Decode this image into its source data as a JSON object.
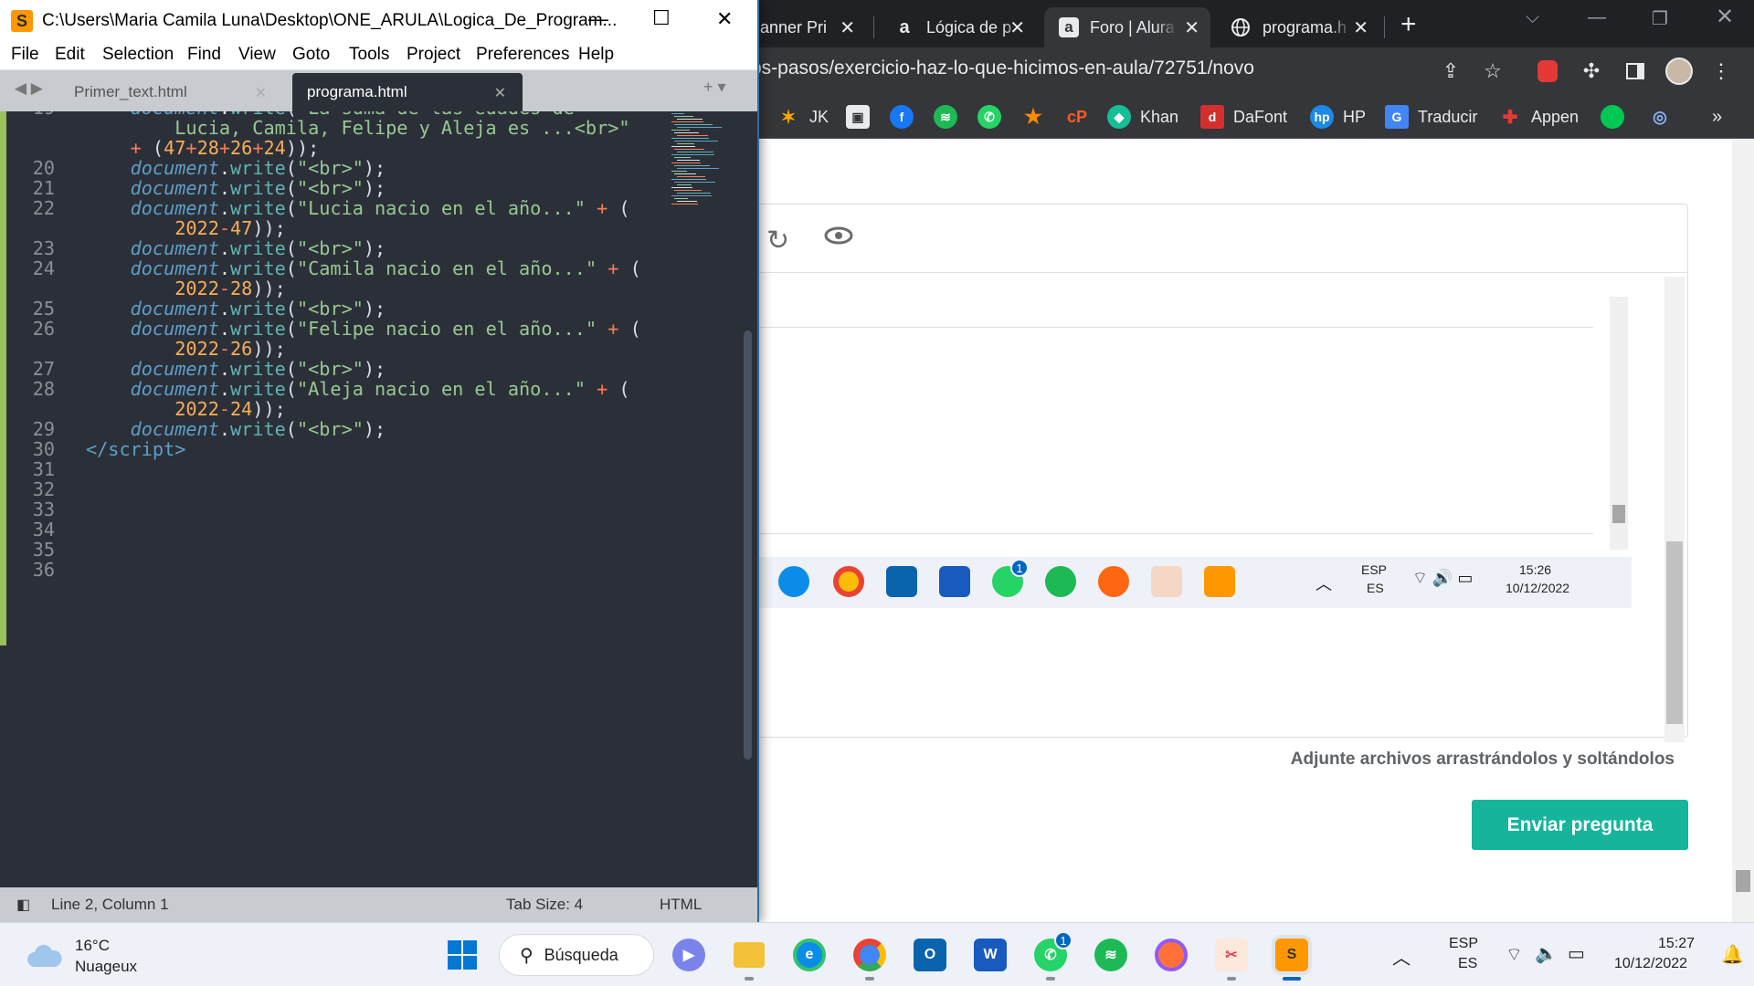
{
  "sublime": {
    "title_path": "C:\\Users\\Maria Camila Luna\\Desktop\\ONE_ARULA\\Logica_De_Program...",
    "menu": [
      "File",
      "Edit",
      "Selection",
      "Find",
      "View",
      "Goto",
      "Tools",
      "Project",
      "Preferences",
      "Help"
    ],
    "tabs": [
      {
        "label": "Primer_text.html",
        "active": false
      },
      {
        "label": "programa.html",
        "active": true
      }
    ],
    "line_numbers": [
      "19",
      "",
      "",
      "20",
      "21",
      "22",
      "",
      "23",
      "24",
      "",
      "25",
      "26",
      "",
      "27",
      "28",
      "",
      "29",
      "30",
      "31",
      "32",
      "33",
      "34",
      "35",
      "36"
    ],
    "status": {
      "position": "Line 2, Column 1",
      "tab_size": "Tab Size: 4",
      "syntax": "HTML"
    },
    "accent": "#97c25c"
  },
  "chrome": {
    "tabs": [
      {
        "title": "anner Pri",
        "icon": "planner-favicon"
      },
      {
        "title": "Lógica de p",
        "icon": "alura-favicon"
      },
      {
        "title": "Foro | Alura",
        "icon": "alura-favicon",
        "active": true
      },
      {
        "title": "programa.h",
        "icon": "globe-favicon"
      }
    ],
    "url": "os-pasos/exercicio-haz-lo-que-hicimos-en-aula/72751/novo",
    "bookmarks": [
      "JK",
      "",
      "",
      "",
      "",
      "",
      "",
      "Khan",
      "DaFont",
      "HP",
      "Traducir",
      "Appen",
      "",
      ""
    ],
    "page": {
      "attach_hint": "Adjunte archivos arrastrándolos y soltándolos",
      "send_button": "Enviar pregunta",
      "button_color": "#15b49b"
    },
    "inner_tray": {
      "lang": "ESP",
      "kb": "ES",
      "time": "15:26",
      "date": "10/12/2022",
      "whatsapp_badge": "1"
    }
  },
  "taskbar": {
    "weather_temp": "16°C",
    "weather_desc": "Nuageux",
    "search_label": "Búsqueda",
    "lang": "ESP",
    "kb": "ES",
    "time": "15:27",
    "date": "10/12/2022",
    "whatsapp_badge": "1"
  }
}
